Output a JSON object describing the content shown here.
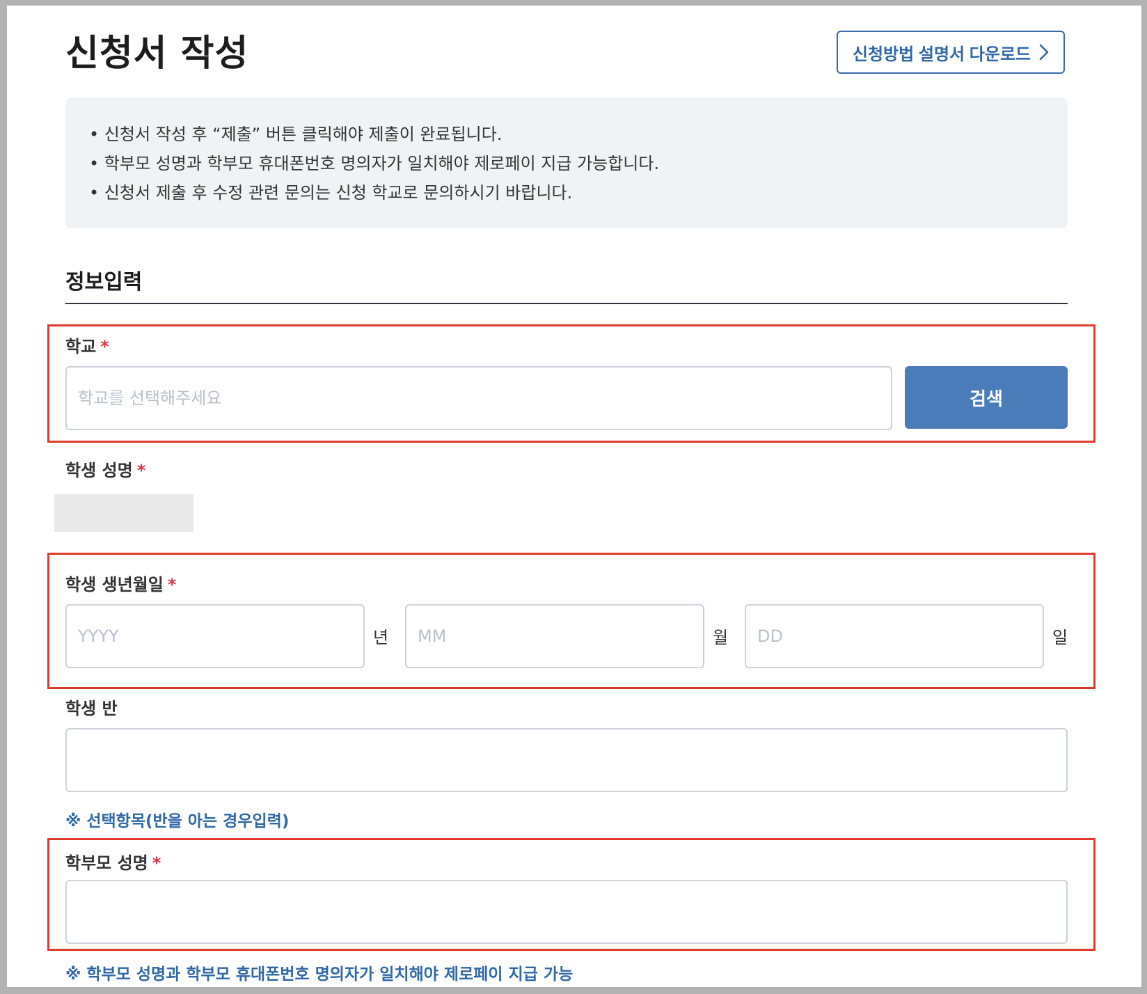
{
  "header": {
    "title": "신청서 작성",
    "download_label": "신청방법 설명서 다운로드"
  },
  "notice": {
    "lines": [
      "신청서 작성 후 “제출” 버튼 클릭해야 제출이 완료됩니다.",
      "학부모 성명과 학부모 휴대폰번호 명의자가 일치해야 제로페이 지급 가능합니다.",
      "신청서 제출 후 수정 관련 문의는 신청 학교로 문의하시기 바랍니다."
    ]
  },
  "form": {
    "section_title": "정보입력",
    "required_mark": "*",
    "school": {
      "label": "학교",
      "placeholder": "학교를 선택해주세요",
      "search_label": "검색"
    },
    "student_name": {
      "label": "학생 성명"
    },
    "birth": {
      "label": "학생 생년월일",
      "year_placeholder": "YYYY",
      "year_unit": "년",
      "month_placeholder": "MM",
      "month_unit": "월",
      "day_placeholder": "DD",
      "day_unit": "일"
    },
    "student_class": {
      "label": "학생 반",
      "hint": "※ 선택항목(반을 아는 경우입력)"
    },
    "parent_name": {
      "label": "학부모 성명",
      "hint": "※ 학부모 성명과 학부모 휴대폰번호 명의자가 일치해야 제로페이 지급 가능"
    }
  },
  "colors": {
    "accent": "#2f67a8",
    "button": "#4a7cb9",
    "highlight": "#e03a2c",
    "required": "#e0334a",
    "notice_bg": "#f0f3f6"
  }
}
